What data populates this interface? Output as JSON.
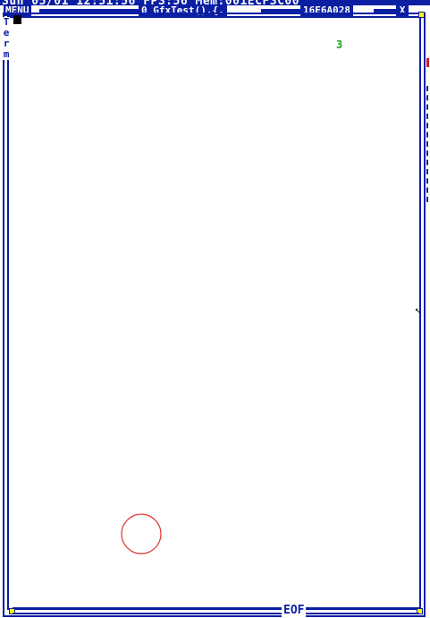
{
  "status_bar": {
    "text": "Sun 05/01 12:51:56 FPS:56 Mem:001ECF3C00"
  },
  "title_bar": {
    "menu_label": "MENU",
    "task_label": "0 GfxTest().{.",
    "task_id": "16E6A028",
    "close_label": "X"
  },
  "side_tab": {
    "letters": [
      "T",
      "e",
      "r",
      "m"
    ]
  },
  "canvas": {
    "number_label": "3"
  },
  "footer": {
    "eof_label": "EOF"
  },
  "colors": {
    "frame_blue": "#0b1fa3",
    "circle_red": "#e23a3a",
    "number_green": "#1aa31a",
    "corner_yellow": "#ffff00"
  },
  "icons": {
    "corner": "corner-marker-icon",
    "resize": "resize-handle-icon"
  }
}
